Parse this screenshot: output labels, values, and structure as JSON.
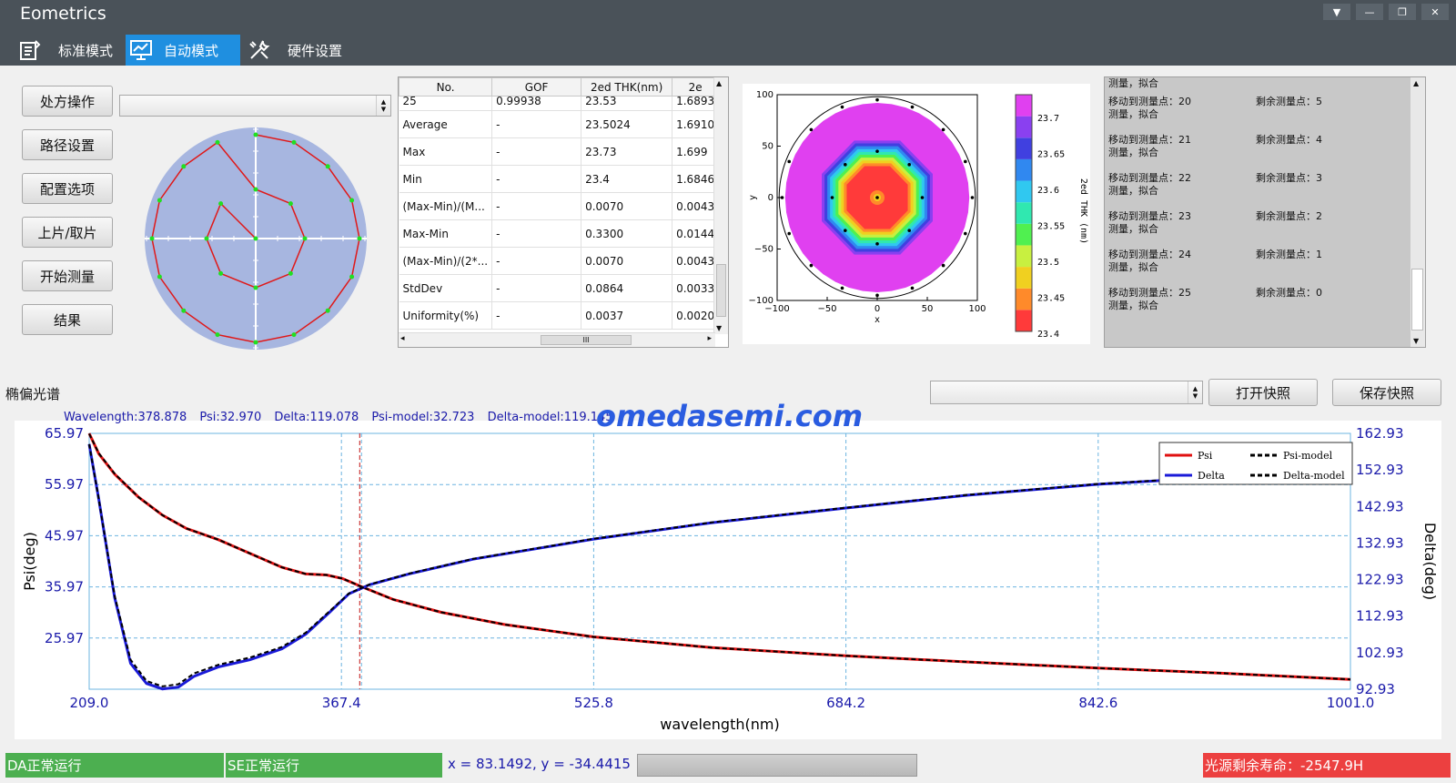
{
  "app": {
    "title": "Eometrics"
  },
  "window_buttons": [
    "▼",
    "—",
    "❐",
    "✕"
  ],
  "tabs": [
    {
      "label": "标准模式",
      "icon": "document-icon"
    },
    {
      "label": "自动模式",
      "icon": "monitor-icon",
      "active": true
    },
    {
      "label": "硬件设置",
      "icon": "tools-icon"
    }
  ],
  "side_buttons": [
    "处方操作",
    "路径设置",
    "配置选项",
    "上片/取片",
    "开始测量",
    "结果"
  ],
  "recipe_combo": {
    "value": ""
  },
  "wafer_map": {
    "points": [
      [
        0,
        95
      ],
      [
        35,
        88
      ],
      [
        66,
        66
      ],
      [
        88,
        35
      ],
      [
        95,
        0
      ],
      [
        88,
        -35
      ],
      [
        66,
        -66
      ],
      [
        35,
        -88
      ],
      [
        0,
        -95
      ],
      [
        -35,
        -88
      ],
      [
        -66,
        -66
      ],
      [
        -88,
        -35
      ],
      [
        -95,
        0
      ],
      [
        -88,
        35
      ],
      [
        -66,
        66
      ],
      [
        -35,
        88
      ],
      [
        0,
        45
      ],
      [
        32,
        32
      ],
      [
        45,
        0
      ],
      [
        32,
        -32
      ],
      [
        0,
        -45
      ],
      [
        -32,
        -32
      ],
      [
        -45,
        0
      ],
      [
        -32,
        32
      ],
      [
        0,
        0
      ]
    ]
  },
  "results_table": {
    "headers": [
      "No.",
      "GOF",
      "2ed THK(nm)",
      "2e"
    ],
    "rows": [
      [
        "25",
        "0.99938",
        "23.53",
        "1.6893"
      ],
      [
        "Average",
        "-",
        "23.5024",
        "1.6910"
      ],
      [
        "Max",
        "-",
        "23.73",
        "1.699"
      ],
      [
        "Min",
        "-",
        "23.4",
        "1.6846"
      ],
      [
        "(Max-Min)/(M...",
        "-",
        "0.0070",
        "0.0043"
      ],
      [
        "Max-Min",
        "-",
        "0.3300",
        "0.0144"
      ],
      [
        "(Max-Min)/(2*...",
        "-",
        "0.0070",
        "0.0043"
      ],
      [
        "StdDev",
        "-",
        "0.0864",
        "0.0033"
      ],
      [
        "Uniformity(%)",
        "-",
        "0.0037",
        "0.0020"
      ]
    ],
    "hscroll_label": "III"
  },
  "contour_map": {
    "x_ticks": [
      "−100",
      "−50",
      "0",
      "50",
      "100"
    ],
    "y_ticks": [
      "100",
      "50",
      "0",
      "−50",
      "−100"
    ],
    "xlabel": "x",
    "ylabel": "y",
    "colorbar_label": "2ed THK (nm)",
    "colorbar_ticks": [
      "23.7",
      "23.65",
      "23.6",
      "23.55",
      "23.5",
      "23.45",
      "23.4"
    ],
    "colors": [
      "#ff3a3a",
      "#ff8a2a",
      "#f0d020",
      "#c8f040",
      "#50f050",
      "#30e8b0",
      "#30c8f0",
      "#3088f0",
      "#4040e0",
      "#8a40f0",
      "#e040f0"
    ]
  },
  "log": {
    "top_partial": {
      "action": "测量，拟合"
    },
    "entries": [
      {
        "move": "移动到测量点：20",
        "action": "测量，拟合",
        "remain": "剩余测量点：5"
      },
      {
        "move": "移动到测量点：21",
        "action": "测量，拟合",
        "remain": "剩余测量点：4"
      },
      {
        "move": "移动到测量点：22",
        "action": "测量，拟合",
        "remain": "剩余测量点：3"
      },
      {
        "move": "移动到测量点：23",
        "action": "测量，拟合",
        "remain": "剩余测量点：2"
      },
      {
        "move": "移动到测量点：24",
        "action": "测量，拟合",
        "remain": "剩余测量点：1"
      },
      {
        "move": "移动到测量点：25",
        "action": "测量，拟合",
        "remain": "剩余测量点：0"
      }
    ]
  },
  "spectrum": {
    "section_label": "椭偏光谱",
    "snapshot_combo": {
      "value": ""
    },
    "open_snapshot_label": "打开快照",
    "save_snapshot_label": "保存快照",
    "watermark": "omedasemi.com",
    "readout": {
      "wavelength": "Wavelength:378.878",
      "psi": "Psi:32.970",
      "delta": "Delta:119.078",
      "psi_model": "Psi-model:32.723",
      "delta_model": "Delta-model:119.145"
    }
  },
  "chart_data": {
    "type": "line",
    "xlabel": "wavelength(nm)",
    "ylabel": "Psi(deg)",
    "y2label": "Delta(deg)",
    "xlim": [
      209.0,
      1001.0
    ],
    "ylim": [
      15.97,
      65.97
    ],
    "y2lim": [
      92.93,
      162.93
    ],
    "x_ticks": [
      "209.0",
      "367.4",
      "525.8",
      "684.2",
      "842.6",
      "1001.0"
    ],
    "y_ticks": [
      "65.97",
      "55.97",
      "45.97",
      "35.97",
      "25.97"
    ],
    "y2_ticks": [
      "162.93",
      "152.93",
      "142.93",
      "132.93",
      "122.93",
      "112.93",
      "102.93",
      "92.93"
    ],
    "cursor_x": 378.878,
    "legend": {
      "position": "top-right",
      "entries": [
        "Psi",
        "Psi-model",
        "Delta",
        "Delta-model"
      ]
    },
    "series": [
      {
        "name": "Psi",
        "axis": "left",
        "color": "#e01010",
        "x": [
          209,
          215,
          225,
          240,
          255,
          270,
          290,
          310,
          330,
          345,
          358,
          368,
          380,
          400,
          430,
          470,
          525.8,
          600,
          684.2,
          760,
          842.6,
          920,
          1001
        ],
        "y": [
          65.97,
          62,
          58,
          53.5,
          50,
          47.4,
          45.2,
          42.5,
          39.8,
          38.5,
          38.3,
          37.6,
          36.0,
          33.5,
          31.0,
          28.6,
          26.2,
          24.1,
          22.5,
          21.3,
          20.1,
          19.1,
          17.9
        ]
      },
      {
        "name": "Psi-model",
        "axis": "left",
        "color": "#000000",
        "dashed": true,
        "x": [
          209,
          215,
          225,
          240,
          255,
          270,
          290,
          310,
          330,
          345,
          358,
          368,
          380,
          400,
          430,
          470,
          525.8,
          600,
          684.2,
          760,
          842.6,
          920,
          1001
        ],
        "y": [
          65.9,
          62.1,
          58.1,
          53.5,
          50.0,
          47.4,
          45.2,
          42.5,
          39.8,
          38.5,
          38.3,
          37.6,
          36.0,
          33.5,
          31.0,
          28.6,
          26.2,
          24.1,
          22.5,
          21.3,
          20.1,
          19.1,
          17.9
        ]
      },
      {
        "name": "Delta",
        "axis": "right",
        "color": "#1a1ad8",
        "x": [
          209,
          215,
          225,
          235,
          245,
          255,
          265,
          275,
          290,
          310,
          330,
          345,
          360,
          372,
          385,
          410,
          450,
          525.8,
          600,
          684.2,
          760,
          842.6,
          920,
          1001
        ],
        "y": [
          160,
          145,
          118,
          100,
          94.5,
          93,
          93.5,
          96.5,
          99,
          101,
          104,
          108,
          114,
          119,
          121.5,
          124.5,
          128.5,
          134,
          138.5,
          142.5,
          146,
          149,
          151,
          153
        ]
      },
      {
        "name": "Delta-model",
        "axis": "right",
        "color": "#000000",
        "dashed": true,
        "x": [
          209,
          215,
          225,
          235,
          245,
          255,
          265,
          275,
          290,
          310,
          330,
          345,
          360,
          372,
          385,
          410,
          450,
          525.8,
          600,
          684.2,
          760,
          842.6,
          920,
          1001
        ],
        "y": [
          160,
          145,
          118.5,
          101,
          95.2,
          93.7,
          94.3,
          97.3,
          99.6,
          101.6,
          104.5,
          108.4,
          114.3,
          119.1,
          121.6,
          124.6,
          128.6,
          134.1,
          138.6,
          142.6,
          146.1,
          149.1,
          151.1,
          153.1
        ]
      }
    ]
  },
  "statusbar": {
    "da": "DA正常运行",
    "se": "SE正常运行",
    "coords": "x = 83.1492, y = -34.4415",
    "progress": 1.0,
    "lamp": "光源剩余寿命：-2547.9H"
  },
  "colors": {
    "accent": "#1f8fe0",
    "titlebar": "#4a5259",
    "ok": "#4caf50",
    "alarm": "#ec4040"
  }
}
